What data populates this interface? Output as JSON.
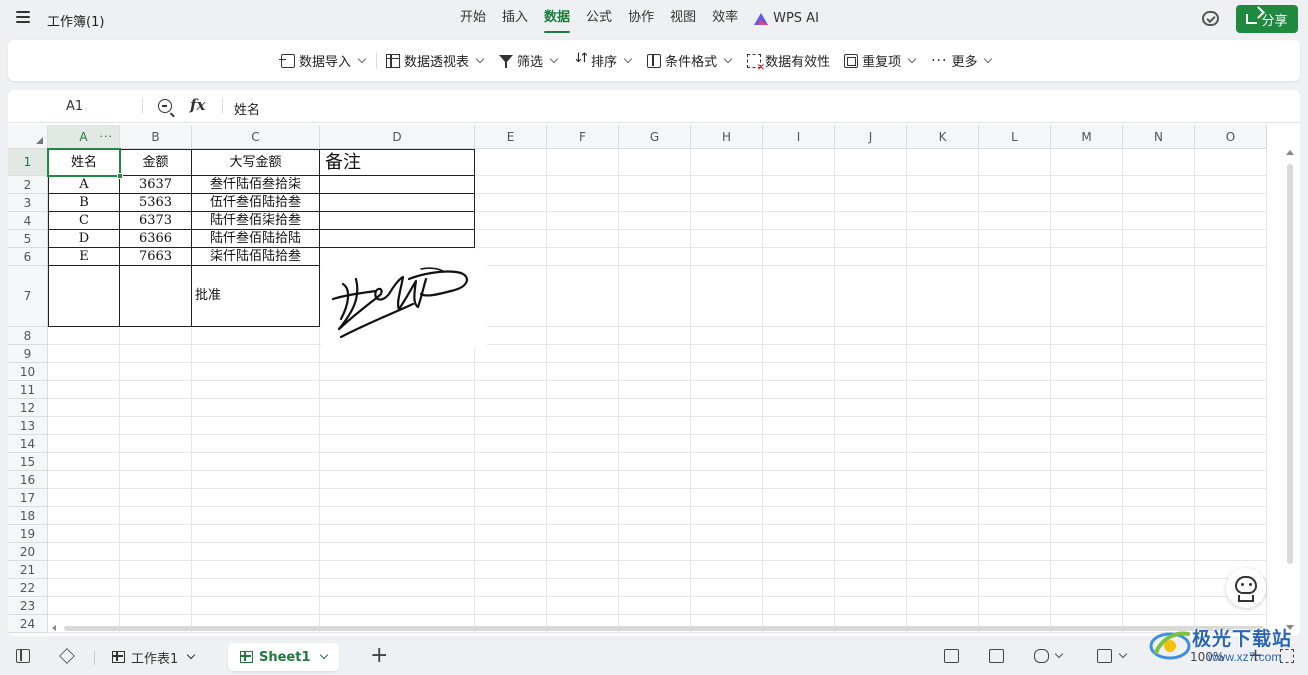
{
  "app": {
    "title": "工作簿(1)",
    "share_label": "分享",
    "accent": "#1f8a3f"
  },
  "menu": {
    "items": [
      "开始",
      "插入",
      "数据",
      "公式",
      "协作",
      "视图",
      "效率"
    ],
    "active": "数据",
    "ai_label": "WPS AI"
  },
  "ribbon": {
    "data_import": "数据导入",
    "pivot": "数据透视表",
    "filter": "筛选",
    "sort": "排序",
    "conditional_format": "条件格式",
    "validation": "数据有效性",
    "duplicates": "重复项",
    "more": "更多"
  },
  "formula_bar": {
    "cell_ref": "A1",
    "fx": "fx",
    "value": "姓名"
  },
  "columns": [
    "A",
    "B",
    "C",
    "D",
    "E",
    "F",
    "G",
    "H",
    "I",
    "J",
    "K",
    "L",
    "M",
    "N",
    "O"
  ],
  "rows": [
    "1",
    "2",
    "3",
    "4",
    "5",
    "6",
    "7",
    "8",
    "9",
    "10",
    "11",
    "12",
    "13",
    "14",
    "15",
    "16",
    "17",
    "18",
    "19",
    "20",
    "21",
    "22",
    "23",
    "24"
  ],
  "table": {
    "headers": [
      "姓名",
      "金额",
      "大写金额",
      "备注"
    ],
    "rows": [
      [
        "A",
        "3637",
        "叁仟陆佰叁拾柒",
        ""
      ],
      [
        "B",
        "5363",
        "伍仟叁佰陆拾叁",
        ""
      ],
      [
        "C",
        "6373",
        "陆仟叁佰柒拾叁",
        ""
      ],
      [
        "D",
        "6366",
        "陆仟叁佰陆拾陆",
        ""
      ],
      [
        "E",
        "7663",
        "柒仟陆佰陆拾叁",
        ""
      ]
    ],
    "approval_label": "批准"
  },
  "sheets": {
    "tabs": [
      "工作表1",
      "Sheet1"
    ],
    "active": "Sheet1"
  },
  "status": {
    "zoom": "100%"
  },
  "watermark": {
    "text": "极光下载站",
    "url": "www.xz7.com"
  }
}
